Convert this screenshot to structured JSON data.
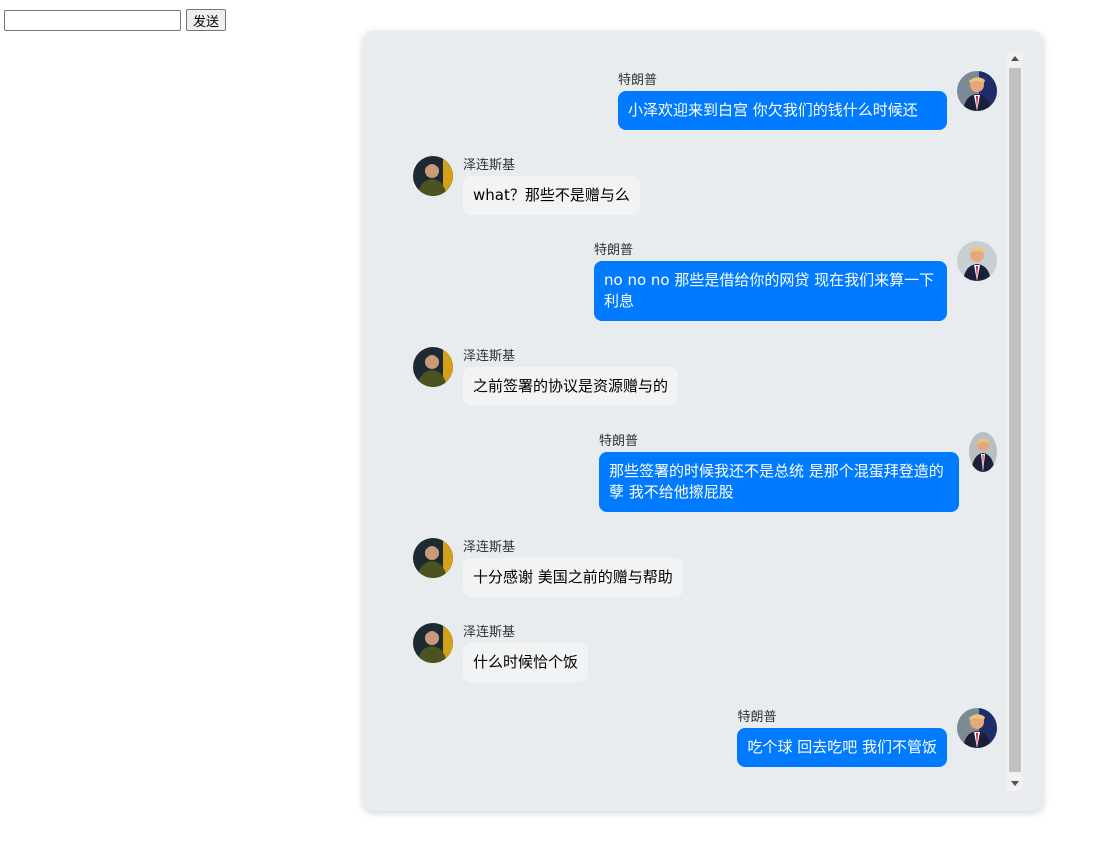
{
  "composer": {
    "input_value": "",
    "input_placeholder": "",
    "send_label": "发送"
  },
  "colors": {
    "panel_bg": "#e9ecef",
    "outgoing_bubble": "#007bff",
    "incoming_bubble": "#f1f3f4"
  },
  "messages": [
    {
      "side": "right",
      "sender": "特朗普",
      "avatar": "trump-avatar",
      "text": "小泽欢迎来到白宫 你欠我们的钱什么时候还"
    },
    {
      "side": "left",
      "sender": "泽连斯基",
      "avatar": "zelensky-avatar",
      "text": "what？那些不是赠与么"
    },
    {
      "side": "right",
      "sender": "特朗普",
      "avatar": "trump-avatar",
      "text": "no no no 那些是借给你的网贷 现在我们来算一下利息"
    },
    {
      "side": "left",
      "sender": "泽连斯基",
      "avatar": "zelensky-avatar",
      "text": "之前签署的协议是资源赠与的"
    },
    {
      "side": "right",
      "sender": "特朗普",
      "avatar": "trump-avatar",
      "text": "那些签署的时候我还不是总统 是那个混蛋拜登造的孽 我不给他擦屁股"
    },
    {
      "side": "left",
      "sender": "泽连斯基",
      "avatar": "zelensky-avatar",
      "text": "十分感谢 美国之前的赠与帮助"
    },
    {
      "side": "left",
      "sender": "泽连斯基",
      "avatar": "zelensky-avatar",
      "text": "什么时候恰个饭"
    },
    {
      "side": "right",
      "sender": "特朗普",
      "avatar": "trump-avatar",
      "text": "吃个球 回去吃吧 我们不管饭"
    }
  ]
}
